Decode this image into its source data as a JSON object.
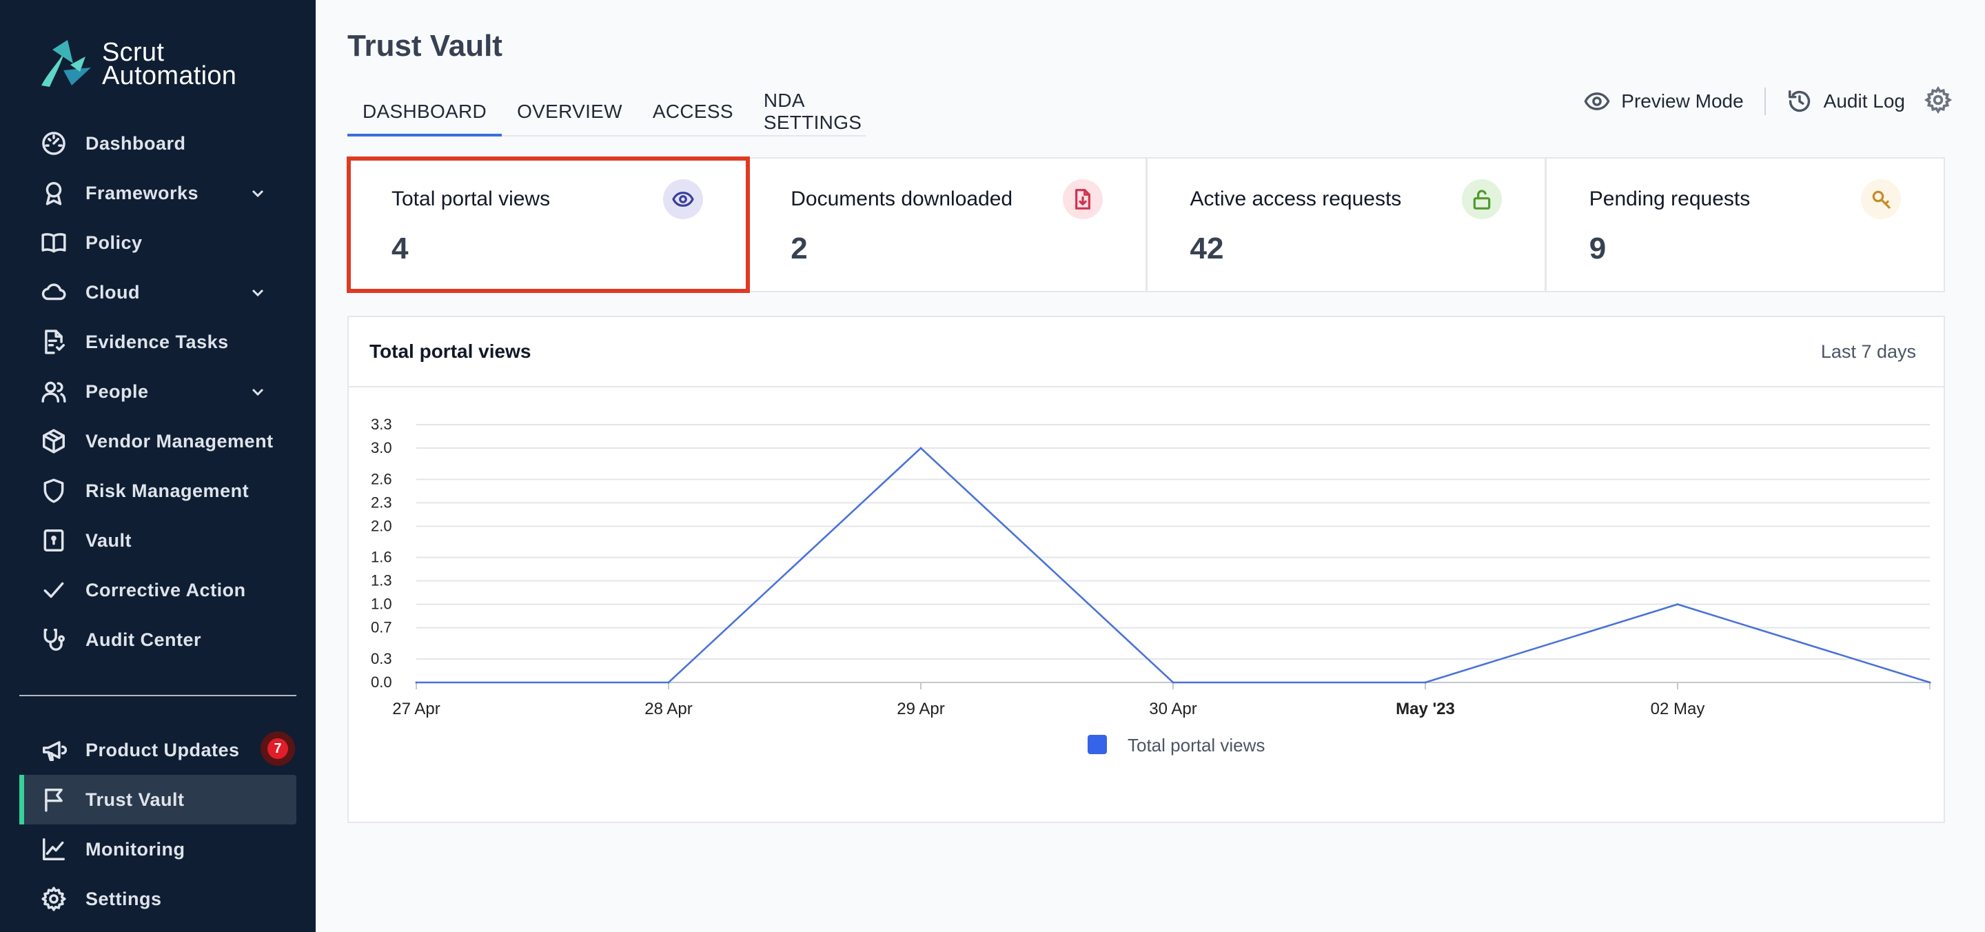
{
  "brand": {
    "line1": "Scrut",
    "line2": "Automation"
  },
  "sidebar": {
    "items": [
      {
        "label": "Dashboard",
        "icon": "dashboard-gauge-icon",
        "chevron": false
      },
      {
        "label": "Frameworks",
        "icon": "award-ribbon-icon",
        "chevron": true
      },
      {
        "label": "Policy",
        "icon": "book-open-icon",
        "chevron": false
      },
      {
        "label": "Cloud",
        "icon": "cloud-icon",
        "chevron": true
      },
      {
        "label": "Evidence Tasks",
        "icon": "file-check-icon",
        "chevron": false
      },
      {
        "label": "People",
        "icon": "users-icon",
        "chevron": true
      },
      {
        "label": "Vendor Management",
        "icon": "cube-icon",
        "chevron": false
      },
      {
        "label": "Risk Management",
        "icon": "shield-icon",
        "chevron": false
      },
      {
        "label": "Vault",
        "icon": "vault-icon",
        "chevron": false
      },
      {
        "label": "Corrective Action",
        "icon": "check-icon",
        "chevron": false
      },
      {
        "label": "Audit Center",
        "icon": "stethoscope-icon",
        "chevron": false
      }
    ],
    "bottom_items": [
      {
        "label": "Product Updates",
        "icon": "megaphone-icon",
        "badge": "7"
      },
      {
        "label": "Trust Vault",
        "icon": "flag-icon",
        "active": true
      },
      {
        "label": "Monitoring",
        "icon": "line-chart-icon"
      },
      {
        "label": "Settings",
        "icon": "gear-icon"
      }
    ]
  },
  "page": {
    "title": "Trust Vault",
    "tabs": [
      {
        "label": "DASHBOARD",
        "active": true
      },
      {
        "label": "OVERVIEW"
      },
      {
        "label": "ACCESS"
      },
      {
        "label": "NDA SETTINGS"
      }
    ],
    "actions": {
      "preview_label": "Preview Mode",
      "audit_label": "Audit Log"
    }
  },
  "stats": [
    {
      "title": "Total portal views",
      "value": "4",
      "icon": "eye-icon",
      "icon_bg": "#e4e3f6",
      "icon_color": "#3b3f9a",
      "highlighted": true
    },
    {
      "title": "Documents downloaded",
      "value": "2",
      "icon": "file-download-icon",
      "icon_bg": "#fde2e6",
      "icon_color": "#d1334f"
    },
    {
      "title": "Active access requests",
      "value": "42",
      "icon": "unlock-icon",
      "icon_bg": "#e3f3de",
      "icon_color": "#4e9a2f"
    },
    {
      "title": "Pending requests",
      "value": "9",
      "icon": "key-search-icon",
      "icon_bg": "#fdf5e7",
      "icon_color": "#c98a2a"
    }
  ],
  "chart_panel": {
    "title": "Total portal views",
    "range": "Last 7 days"
  },
  "chart_data": {
    "type": "line",
    "categories": [
      "27 Apr",
      "28 Apr",
      "29 Apr",
      "30 Apr",
      "May '23",
      "02 May",
      ""
    ],
    "series": [
      {
        "name": "Total portal views",
        "values": [
          0,
          0,
          3,
          0,
          0,
          1,
          0
        ],
        "color": "#4a72d8"
      }
    ],
    "yticks": [
      "0.0",
      "0.3",
      "0.7",
      "1.0",
      "1.3",
      "1.6",
      "2.0",
      "2.3",
      "2.6",
      "3.0",
      "3.3"
    ],
    "ylim": [
      0,
      3.3
    ],
    "grid": true,
    "legend": "bottom-center",
    "legend_swatch": "#3563e9"
  }
}
